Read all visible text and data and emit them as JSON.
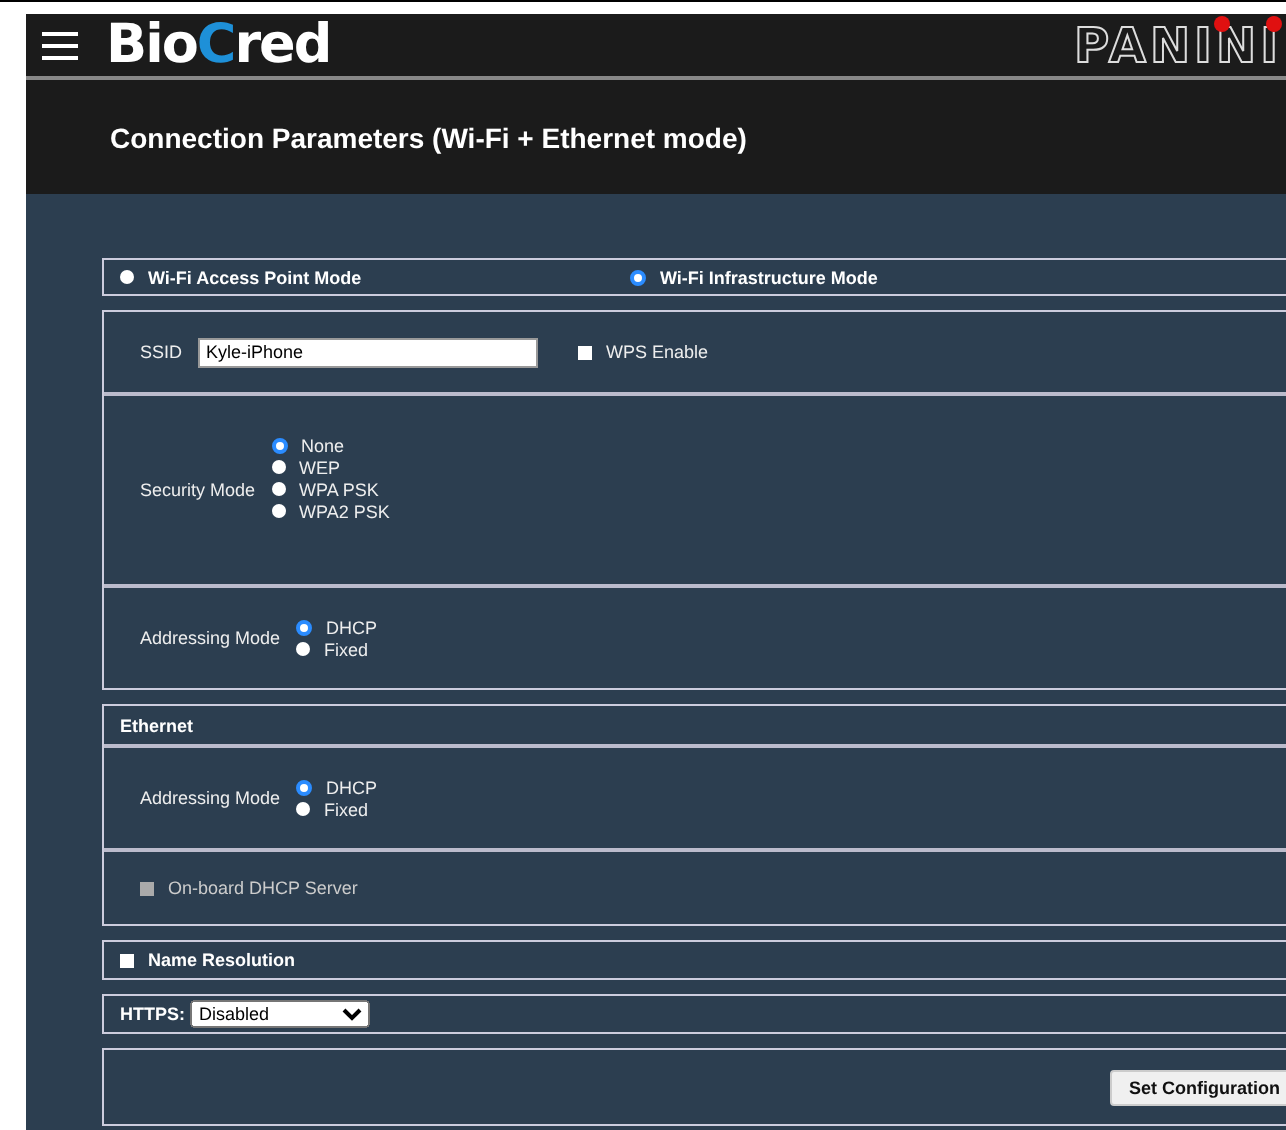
{
  "header": {
    "brand": [
      {
        "text": "Bio",
        "accent": false
      },
      {
        "text": "C",
        "accent": true
      },
      {
        "text": "red",
        "accent": false
      }
    ],
    "partner_logo": "PANINI"
  },
  "page_title": "Connection Parameters (Wi-Fi + Ethernet mode)",
  "wifi_modes": [
    {
      "label": "Wi-Fi Access Point Mode",
      "selected": false
    },
    {
      "label": "Wi-Fi Infrastructure Mode",
      "selected": true
    }
  ],
  "wifi": {
    "ssid_label": "SSID",
    "ssid_value": "Kyle-iPhone",
    "wps": {
      "label": "WPS Enable",
      "checked": false
    },
    "security": {
      "label": "Security Mode",
      "options": [
        {
          "label": "None",
          "selected": true
        },
        {
          "label": "WEP",
          "selected": false
        },
        {
          "label": "WPA PSK",
          "selected": false
        },
        {
          "label": "WPA2 PSK",
          "selected": false
        }
      ]
    },
    "addressing": {
      "label": "Addressing Mode",
      "options": [
        {
          "label": "DHCP",
          "selected": true
        },
        {
          "label": "Fixed",
          "selected": false
        }
      ]
    }
  },
  "ethernet": {
    "title": "Ethernet",
    "addressing": {
      "label": "Addressing Mode",
      "options": [
        {
          "label": "DHCP",
          "selected": true
        },
        {
          "label": "Fixed",
          "selected": false
        }
      ]
    },
    "dhcp_server": {
      "label": "On-board DHCP Server",
      "checked": false,
      "disabled": true
    }
  },
  "name_resolution": {
    "label": "Name Resolution",
    "checked": false
  },
  "https": {
    "label": "HTTPS:",
    "value": "Disabled"
  },
  "submit": "Set Configuration"
}
